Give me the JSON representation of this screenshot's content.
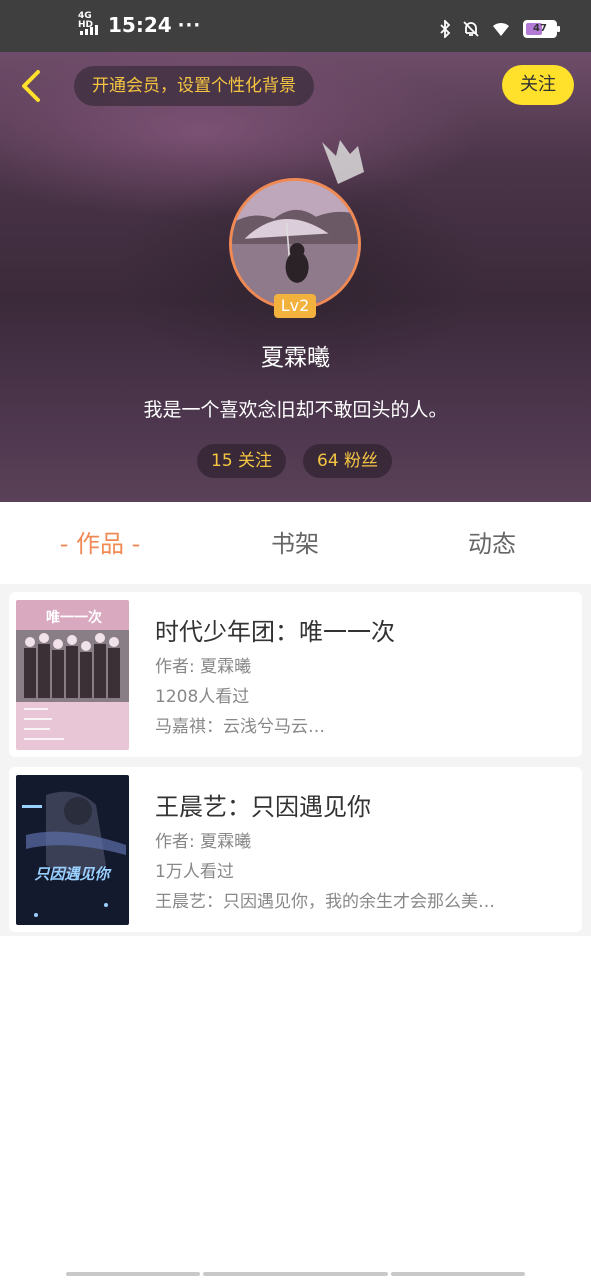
{
  "status_bar": {
    "network": "4G HD",
    "time": "15:24",
    "more": "···",
    "battery": "47"
  },
  "header": {
    "vip_promo": "开通会员，设置个性化背景",
    "follow_label": "关注",
    "level": "Lv2",
    "username": "夏霖曦",
    "bio": "我是一个喜欢念旧却不敢回头的人。",
    "following": "15 关注",
    "followers": "64 粉丝"
  },
  "tabs": [
    {
      "label": "- 作品 -",
      "active": true
    },
    {
      "label": "书架",
      "active": false
    },
    {
      "label": "动态",
      "active": false
    }
  ],
  "works": [
    {
      "title": "时代少年团：唯一一次",
      "author": "作者: 夏霖曦",
      "views": "1208人看过",
      "desc": "马嘉祺：云浅兮马云…",
      "cover_title": "唯一一次"
    },
    {
      "title": "王晨艺：只因遇见你",
      "author": "作者: 夏霖曦",
      "views": "1万人看过",
      "desc": "王晨艺：只因遇见你，我的余生才会那么美…",
      "cover_title": "只因遇见你"
    }
  ],
  "colors": {
    "accent": "#f08a55",
    "follow_button": "#ffe02b",
    "vip_text": "#f5c542",
    "level_badge": "#f3b13e"
  },
  "icons": [
    "back-arrow-icon",
    "crown-icon",
    "bluetooth-icon",
    "mute-icon",
    "wifi-icon",
    "battery-icon"
  ]
}
